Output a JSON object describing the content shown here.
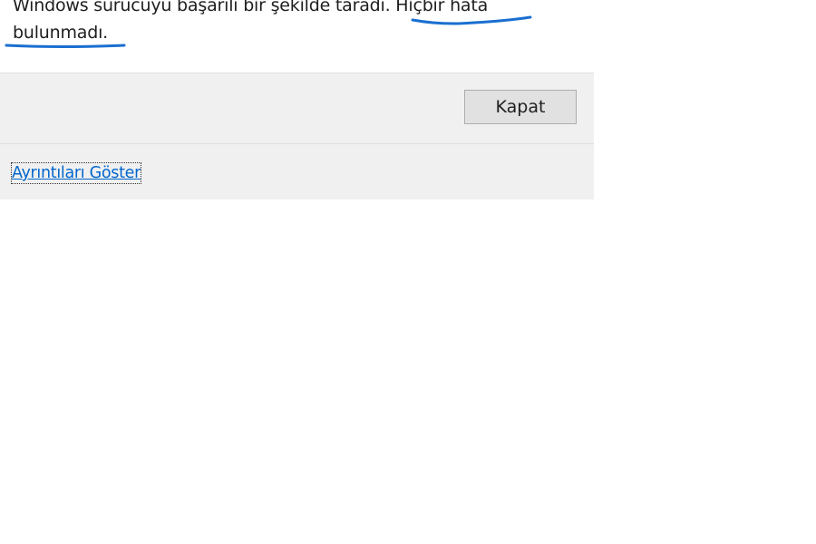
{
  "dialog": {
    "message": "Windows sürücüyü başarılı bir şekilde taradı. Hiçbir hata bulunmadı.",
    "close_label": "Kapat",
    "details_label": "Ayrıntıları Göster"
  },
  "colors": {
    "annotation": "#1a6fd0",
    "link": "#0066cc",
    "panel": "#f0f0f0",
    "button": "#e1e1e1"
  }
}
